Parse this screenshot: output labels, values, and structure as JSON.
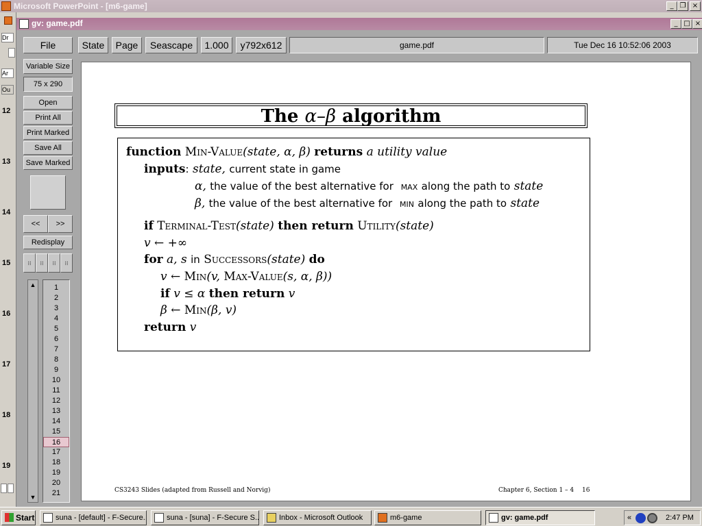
{
  "ppt": {
    "title": "Microsoft PowerPoint - [m6-game]",
    "left_labels": [
      "Dr",
      "Ar",
      "Ou"
    ],
    "slide_numbers": [
      "12",
      "13",
      "14",
      "15",
      "16",
      "17",
      "18",
      "19"
    ]
  },
  "gv": {
    "title": "gv: game.pdf",
    "toolbar": {
      "file": "File",
      "state": "State",
      "page": "Page",
      "orientation": "Seascape",
      "scale": "1.000",
      "media": "y792x612",
      "filename": "game.pdf",
      "date": "Tue Dec 16 10:52:06 2003"
    },
    "side": {
      "variable_size": "Variable Size",
      "dimensions": "75 x 290",
      "open": "Open",
      "print_all": "Print All",
      "print_marked": "Print Marked",
      "save_all": "Save All",
      "save_marked": "Save Marked",
      "prev": "<<",
      "next": ">>",
      "redisplay": "Redisplay"
    },
    "pages": [
      "1",
      "2",
      "3",
      "4",
      "5",
      "6",
      "7",
      "8",
      "9",
      "10",
      "11",
      "12",
      "13",
      "14",
      "15",
      "16",
      "17",
      "18",
      "19",
      "20",
      "21"
    ],
    "current_page": "16"
  },
  "slide": {
    "title_pre": "The ",
    "title_sym": "α–β",
    "title_post": " algorithm",
    "l1_kw1": "function",
    "l1_fn": "Min-Value",
    "l1_args": "(state, α, β)",
    "l1_kw2": "returns",
    "l1_ret": "a utility value",
    "l2_kw": "inputs",
    "l2_colon": ":",
    "l2_var": "state,",
    "l2_text": "current state in game",
    "l3_var": "α,",
    "l3_text1": "the value of the best alternative for",
    "l3_sc": "max",
    "l3_text2": "along the path to",
    "l3_var2": "state",
    "l4_var": "β,",
    "l4_text1": "the value of the best alternative for",
    "l4_sc": "min",
    "l4_text2": "along the path to",
    "l4_var2": "state",
    "l5_kw1": "if",
    "l5_fn": "Terminal-Test",
    "l5_arg": "(state)",
    "l5_kw2": "then return",
    "l5_fn2": "Utility",
    "l5_arg2": "(state)",
    "l6": "v ← +∞",
    "l7_kw1": "for",
    "l7_vars": "a, s",
    "l7_in": "in",
    "l7_fn": "Successors",
    "l7_arg": "(state)",
    "l7_kw2": "do",
    "l8_pre": "v ← ",
    "l8_fn": "Min",
    "l8_mid": "(v, ",
    "l8_fn2": "Max-Value",
    "l8_arg": "(s, α, β))",
    "l9_kw1": "if",
    "l9_cond": "v ≤ α",
    "l9_kw2": "then return",
    "l9_var": "v",
    "l10_pre": "β ← ",
    "l10_fn": "Min",
    "l10_arg": "(β, v)",
    "l11_kw": "return",
    "l11_var": "v",
    "footer_left": "CS3243 Slides (adapted from Russell and Norvig)",
    "footer_right": "Chapter 6, Section 1 – 4",
    "footer_page": "16"
  },
  "taskbar": {
    "start": "Start",
    "tasks": [
      "suna - [default] - F-Secure...",
      "suna - [suna] - F-Secure S...",
      "Inbox - Microsoft Outlook",
      "m6-game",
      "gv: game.pdf"
    ],
    "tray_chevron": "«",
    "clock": "2:47 PM"
  }
}
